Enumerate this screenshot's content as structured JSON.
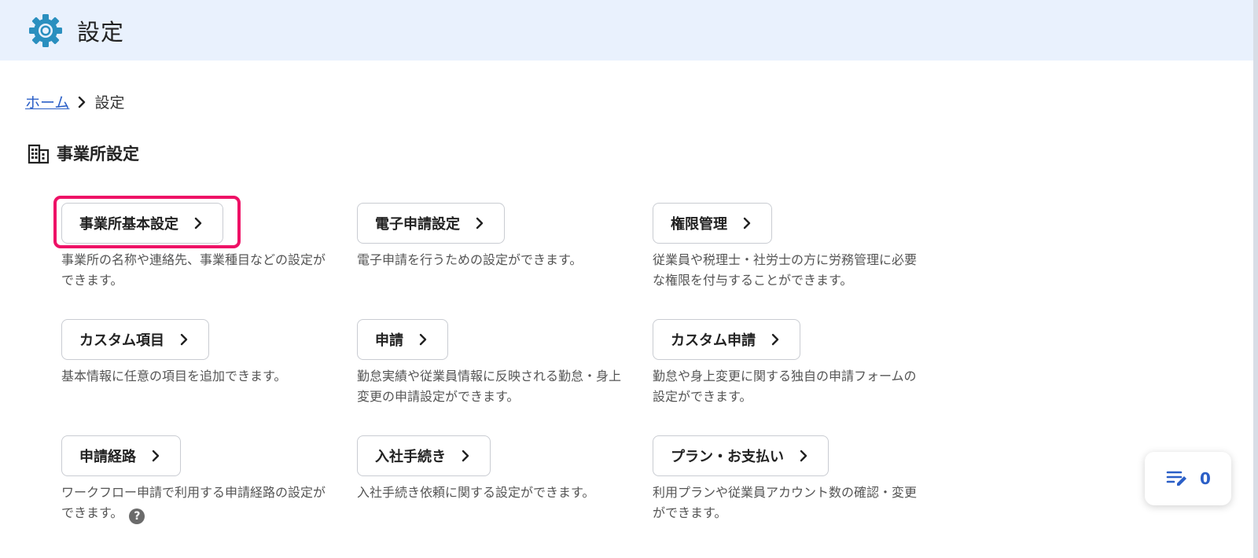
{
  "header": {
    "title": "設定",
    "icon": "gear-icon",
    "icon_color": "#2a8fbf"
  },
  "breadcrumb": {
    "home": "ホーム",
    "current": "設定"
  },
  "section": {
    "title": "事業所設定",
    "icon": "building-icon"
  },
  "cards": [
    {
      "label": "事業所基本設定",
      "desc": "事業所の名称や連絡先、事業種目などの設定ができます。"
    },
    {
      "label": "電子申請設定",
      "desc": "電子申請を行うための設定ができます。"
    },
    {
      "label": "権限管理",
      "desc": "従業員や税理士・社労士の方に労務管理に必要な権限を付与することができます。"
    },
    {
      "label": "カスタム項目",
      "desc": "基本情報に任意の項目を追加できます。"
    },
    {
      "label": "申請",
      "desc": "勤怠実績や従業員情報に反映される勤怠・身上変更の申請設定ができます。"
    },
    {
      "label": "カスタム申請",
      "desc": "勤怠や身上変更に関する独自の申請フォームの設定ができます。"
    },
    {
      "label": "申請経路",
      "desc": "ワークフロー申請で利用する申請経路の設定ができます。"
    },
    {
      "label": "入社手続き",
      "desc": "入社手続き依頼に関する設定ができます。"
    },
    {
      "label": "プラン・お支払い",
      "desc": "利用プランや従業員アカウント数の確認・変更ができます。"
    }
  ],
  "help_glyph": "?",
  "floating": {
    "count": "0",
    "icon": "edit-list-icon"
  },
  "colors": {
    "header_bg": "#e9f1fd",
    "link": "#2b5fc7",
    "highlight": "#ee1166"
  }
}
